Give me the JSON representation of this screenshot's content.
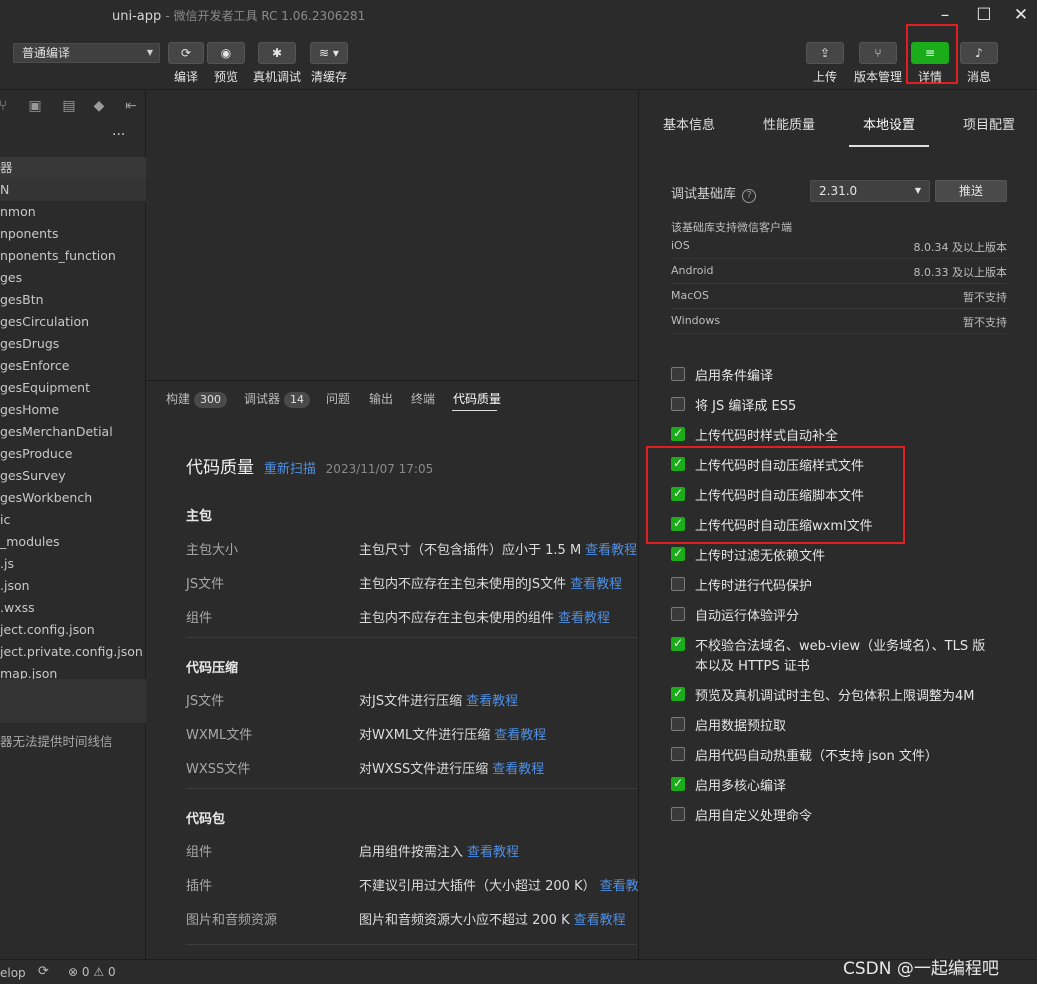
{
  "window": {
    "title": "uni-app",
    "subtitle": "- 微信开发者工具 RC 1.06.2306281"
  },
  "toolbar": {
    "compile_mode": "普通编译",
    "buttons_left": [
      {
        "label": "编译",
        "icon": "refresh-icon"
      },
      {
        "label": "预览",
        "icon": "eye-icon"
      },
      {
        "label": "真机调试",
        "icon": "bug-icon"
      },
      {
        "label": "清缓存",
        "icon": "layers-icon"
      }
    ],
    "buttons_right": [
      {
        "label": "上传",
        "icon": "upload-icon"
      },
      {
        "label": "版本管理",
        "icon": "branch-icon"
      },
      {
        "label": "详情",
        "icon": "menu-icon"
      },
      {
        "label": "消息",
        "icon": "bell-icon"
      }
    ],
    "accent_color": "#1aad19",
    "highlight_color": "#e02020"
  },
  "sidebar": {
    "more": "···",
    "items": [
      "器",
      "N",
      "nmon",
      "nponents",
      "nponents_function",
      "ges",
      "gesBtn",
      "gesCirculation",
      "gesDrugs",
      "gesEnforce",
      "gesEquipment",
      "gesHome",
      "gesMerchanDetial",
      "gesProduce",
      "gesSurvey",
      "gesWorkbench",
      "ic",
      "_modules",
      ".js",
      ".json",
      ".wxss",
      "ject.config.json",
      "ject.private.config.json",
      "map.json"
    ],
    "timeline_note": "器无法提供时间线信"
  },
  "bottom_panel": {
    "tabs": [
      {
        "label": "构建",
        "badge": "300"
      },
      {
        "label": "调试器",
        "badge": "14"
      },
      {
        "label": "问题",
        "badge": ""
      },
      {
        "label": "输出",
        "badge": ""
      },
      {
        "label": "终端",
        "badge": ""
      },
      {
        "label": "代码质量",
        "badge": ""
      }
    ],
    "title": "代码质量",
    "rescan": "重新扫描",
    "scan_time": "2023/11/07 17:05",
    "sections": [
      {
        "heading": "主包",
        "rows": [
          {
            "label": "主包大小",
            "desc": "主包尺寸（不包含插件）应小于 1.5 M",
            "link": "查看教程"
          },
          {
            "label": "JS文件",
            "desc": "主包内不应存在主包未使用的JS文件",
            "link": "查看教程"
          },
          {
            "label": "组件",
            "desc": "主包内不应存在主包未使用的组件",
            "link": "查看教程"
          }
        ]
      },
      {
        "heading": "代码压缩",
        "rows": [
          {
            "label": "JS文件",
            "desc": "对JS文件进行压缩",
            "link": "查看教程"
          },
          {
            "label": "WXML文件",
            "desc": "对WXML文件进行压缩",
            "link": "查看教程"
          },
          {
            "label": "WXSS文件",
            "desc": "对WXSS文件进行压缩",
            "link": "查看教程"
          }
        ]
      },
      {
        "heading": "代码包",
        "rows": [
          {
            "label": "组件",
            "desc": "启用组件按需注入",
            "link": "查看教程"
          },
          {
            "label": "插件",
            "desc": "不建议引用过大插件（大小超过 200 K）",
            "link": "查看教程"
          },
          {
            "label": "图片和音频资源",
            "desc": "图片和音频资源大小应不超过 200 K",
            "link": "查看教程"
          }
        ]
      }
    ]
  },
  "details": {
    "tabs": [
      "基本信息",
      "性能质量",
      "本地设置",
      "项目配置"
    ],
    "active_tab": "本地设置",
    "lib_label": "调试基础库",
    "lib_version": "2.31.0",
    "push_button": "推送",
    "support_note": "该基础库支持微信客户端",
    "platforms": [
      {
        "name": "iOS",
        "value": "8.0.34 及以上版本"
      },
      {
        "name": "Android",
        "value": "8.0.33 及以上版本"
      },
      {
        "name": "MacOS",
        "value": "暂不支持"
      },
      {
        "name": "Windows",
        "value": "暂不支持"
      }
    ],
    "options": [
      {
        "label": "启用条件编译",
        "checked": false
      },
      {
        "label": "将 JS 编译成 ES5",
        "checked": false
      },
      {
        "label": "上传代码时样式自动补全",
        "checked": true
      },
      {
        "label": "上传代码时自动压缩样式文件",
        "checked": true
      },
      {
        "label": "上传代码时自动压缩脚本文件",
        "checked": true
      },
      {
        "label": "上传代码时自动压缩wxml文件",
        "checked": true
      },
      {
        "label": "上传时过滤无依赖文件",
        "checked": true
      },
      {
        "label": "上传时进行代码保护",
        "checked": false
      },
      {
        "label": "自动运行体验评分",
        "checked": false
      },
      {
        "label": "不校验合法域名、web-view（业务域名）、TLS 版",
        "label2": "本以及 HTTPS 证书",
        "checked": true
      },
      {
        "label": "预览及真机调试时主包、分包体积上限调整为4M",
        "checked": true
      },
      {
        "label": "启用数据预拉取",
        "checked": false
      },
      {
        "label": "启用代码自动热重载（不支持 json 文件）",
        "checked": false
      },
      {
        "label": "启用多核心编译",
        "checked": true
      },
      {
        "label": "启用自定义处理命令",
        "checked": false
      }
    ]
  },
  "statusbar": {
    "left": "elop",
    "issues": "0",
    "warnings": "0",
    "watermark": "CSDN @一起编程吧"
  }
}
